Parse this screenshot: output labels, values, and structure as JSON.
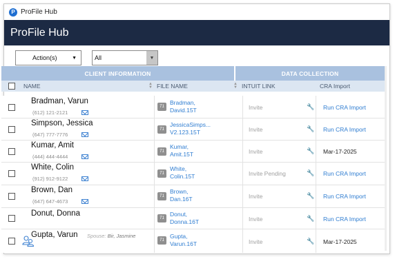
{
  "window": {
    "title": "ProFile Hub",
    "logo_letter": "P"
  },
  "header": {
    "title": "ProFile Hub"
  },
  "toolbar": {
    "actions_label": "Action(s)",
    "actions_caret": "▼",
    "filter_value": "All",
    "filter_caret": "▼"
  },
  "groups": {
    "client_info": "CLIENT INFORMATION",
    "data_collection": "DATA COLLECTION"
  },
  "columns": {
    "name": "NAME",
    "file_name": "FILE NAME",
    "intuit_link": "INTUIT LINK",
    "cra_import": "CRA Import"
  },
  "rows": [
    {
      "name": "Bradman, Varun",
      "phone": "(612) 121-2121",
      "file_line1": "Bradman,",
      "file_line2": "David.15T",
      "intuit": "Invite",
      "cra": "Run CRA Import",
      "cra_is_link": true,
      "file_badge": "T1"
    },
    {
      "name": "Simpson, Jessica",
      "phone": "(647) 777-7776",
      "file_line1": "JessicaSimps...",
      "file_line2": "V2.123.15T",
      "intuit": "Invite",
      "cra": "Run CRA Import",
      "cra_is_link": true,
      "file_badge": "T1"
    },
    {
      "name": "Kumar, Amit",
      "phone": "(444) 444-4444",
      "file_line1": "Kumar,",
      "file_line2": "Amit.15T",
      "intuit": "Invite",
      "cra": "Mar-17-2025",
      "cra_is_link": false,
      "file_badge": "T1"
    },
    {
      "name": "White, Colin",
      "phone": "(912) 912-9122",
      "file_line1": "White,",
      "file_line2": "Colin.15T",
      "intuit": "Invite Pending",
      "cra": "Run CRA Import",
      "cra_is_link": true,
      "file_badge": "T1"
    },
    {
      "name": "Brown, Dan",
      "phone": "(647) 647-4673",
      "file_line1": "Brown,",
      "file_line2": "Dan.16T",
      "intuit": "Invite",
      "cra": "Run CRA Import",
      "cra_is_link": true,
      "file_badge": "T1"
    },
    {
      "name": "Donut, Donna",
      "phone": "",
      "file_line1": "Donut,",
      "file_line2": "Donna.16T",
      "intuit": "Invite",
      "cra": "Run CRA Import",
      "cra_is_link": true,
      "file_badge": "T1"
    },
    {
      "name": "Gupta, Varun",
      "phone": "",
      "spouse_label": "Spouse:",
      "spouse_name": "Bir, Jasmine",
      "file_line1": "Gupta,",
      "file_line2": "Varun.16T",
      "intuit": "Invite",
      "cra": "Mar-17-2025",
      "cra_is_link": false,
      "file_badge": "T1"
    }
  ],
  "colors": {
    "header_bg": "#1c2a44",
    "group_bg": "#a9c1df",
    "colhead_bg": "#dce6f2",
    "link": "#2f7dd1"
  },
  "icons": {
    "mail": "mail-icon",
    "wrench": "wrench-icon",
    "people": "family-icon"
  }
}
